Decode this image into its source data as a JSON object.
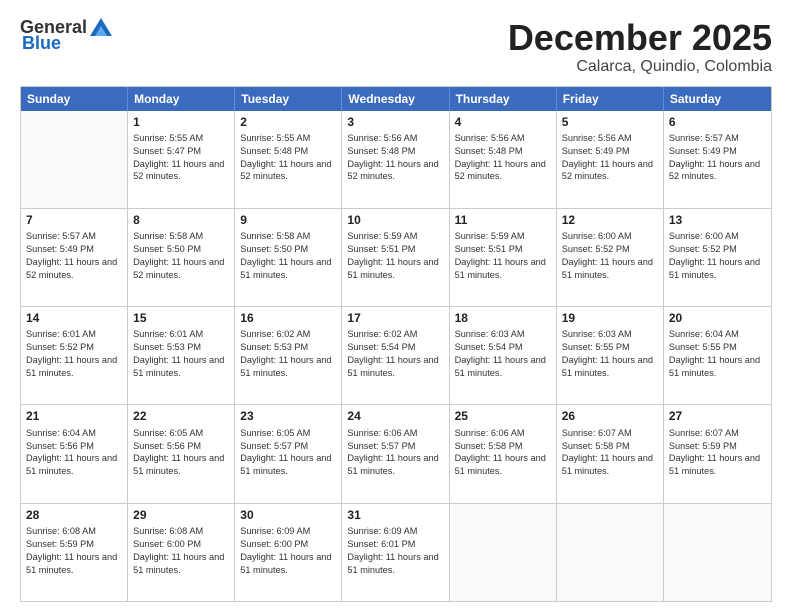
{
  "logo": {
    "general": "General",
    "blue": "Blue"
  },
  "title": "December 2025",
  "location": "Calarca, Quindio, Colombia",
  "header_days": [
    "Sunday",
    "Monday",
    "Tuesday",
    "Wednesday",
    "Thursday",
    "Friday",
    "Saturday"
  ],
  "weeks": [
    [
      {
        "day": "",
        "sunrise": "",
        "sunset": "",
        "daylight": ""
      },
      {
        "day": "1",
        "sunrise": "Sunrise: 5:55 AM",
        "sunset": "Sunset: 5:47 PM",
        "daylight": "Daylight: 11 hours and 52 minutes."
      },
      {
        "day": "2",
        "sunrise": "Sunrise: 5:55 AM",
        "sunset": "Sunset: 5:48 PM",
        "daylight": "Daylight: 11 hours and 52 minutes."
      },
      {
        "day": "3",
        "sunrise": "Sunrise: 5:56 AM",
        "sunset": "Sunset: 5:48 PM",
        "daylight": "Daylight: 11 hours and 52 minutes."
      },
      {
        "day": "4",
        "sunrise": "Sunrise: 5:56 AM",
        "sunset": "Sunset: 5:48 PM",
        "daylight": "Daylight: 11 hours and 52 minutes."
      },
      {
        "day": "5",
        "sunrise": "Sunrise: 5:56 AM",
        "sunset": "Sunset: 5:49 PM",
        "daylight": "Daylight: 11 hours and 52 minutes."
      },
      {
        "day": "6",
        "sunrise": "Sunrise: 5:57 AM",
        "sunset": "Sunset: 5:49 PM",
        "daylight": "Daylight: 11 hours and 52 minutes."
      }
    ],
    [
      {
        "day": "7",
        "sunrise": "Sunrise: 5:57 AM",
        "sunset": "Sunset: 5:49 PM",
        "daylight": "Daylight: 11 hours and 52 minutes."
      },
      {
        "day": "8",
        "sunrise": "Sunrise: 5:58 AM",
        "sunset": "Sunset: 5:50 PM",
        "daylight": "Daylight: 11 hours and 52 minutes."
      },
      {
        "day": "9",
        "sunrise": "Sunrise: 5:58 AM",
        "sunset": "Sunset: 5:50 PM",
        "daylight": "Daylight: 11 hours and 51 minutes."
      },
      {
        "day": "10",
        "sunrise": "Sunrise: 5:59 AM",
        "sunset": "Sunset: 5:51 PM",
        "daylight": "Daylight: 11 hours and 51 minutes."
      },
      {
        "day": "11",
        "sunrise": "Sunrise: 5:59 AM",
        "sunset": "Sunset: 5:51 PM",
        "daylight": "Daylight: 11 hours and 51 minutes."
      },
      {
        "day": "12",
        "sunrise": "Sunrise: 6:00 AM",
        "sunset": "Sunset: 5:52 PM",
        "daylight": "Daylight: 11 hours and 51 minutes."
      },
      {
        "day": "13",
        "sunrise": "Sunrise: 6:00 AM",
        "sunset": "Sunset: 5:52 PM",
        "daylight": "Daylight: 11 hours and 51 minutes."
      }
    ],
    [
      {
        "day": "14",
        "sunrise": "Sunrise: 6:01 AM",
        "sunset": "Sunset: 5:52 PM",
        "daylight": "Daylight: 11 hours and 51 minutes."
      },
      {
        "day": "15",
        "sunrise": "Sunrise: 6:01 AM",
        "sunset": "Sunset: 5:53 PM",
        "daylight": "Daylight: 11 hours and 51 minutes."
      },
      {
        "day": "16",
        "sunrise": "Sunrise: 6:02 AM",
        "sunset": "Sunset: 5:53 PM",
        "daylight": "Daylight: 11 hours and 51 minutes."
      },
      {
        "day": "17",
        "sunrise": "Sunrise: 6:02 AM",
        "sunset": "Sunset: 5:54 PM",
        "daylight": "Daylight: 11 hours and 51 minutes."
      },
      {
        "day": "18",
        "sunrise": "Sunrise: 6:03 AM",
        "sunset": "Sunset: 5:54 PM",
        "daylight": "Daylight: 11 hours and 51 minutes."
      },
      {
        "day": "19",
        "sunrise": "Sunrise: 6:03 AM",
        "sunset": "Sunset: 5:55 PM",
        "daylight": "Daylight: 11 hours and 51 minutes."
      },
      {
        "day": "20",
        "sunrise": "Sunrise: 6:04 AM",
        "sunset": "Sunset: 5:55 PM",
        "daylight": "Daylight: 11 hours and 51 minutes."
      }
    ],
    [
      {
        "day": "21",
        "sunrise": "Sunrise: 6:04 AM",
        "sunset": "Sunset: 5:56 PM",
        "daylight": "Daylight: 11 hours and 51 minutes."
      },
      {
        "day": "22",
        "sunrise": "Sunrise: 6:05 AM",
        "sunset": "Sunset: 5:56 PM",
        "daylight": "Daylight: 11 hours and 51 minutes."
      },
      {
        "day": "23",
        "sunrise": "Sunrise: 6:05 AM",
        "sunset": "Sunset: 5:57 PM",
        "daylight": "Daylight: 11 hours and 51 minutes."
      },
      {
        "day": "24",
        "sunrise": "Sunrise: 6:06 AM",
        "sunset": "Sunset: 5:57 PM",
        "daylight": "Daylight: 11 hours and 51 minutes."
      },
      {
        "day": "25",
        "sunrise": "Sunrise: 6:06 AM",
        "sunset": "Sunset: 5:58 PM",
        "daylight": "Daylight: 11 hours and 51 minutes."
      },
      {
        "day": "26",
        "sunrise": "Sunrise: 6:07 AM",
        "sunset": "Sunset: 5:58 PM",
        "daylight": "Daylight: 11 hours and 51 minutes."
      },
      {
        "day": "27",
        "sunrise": "Sunrise: 6:07 AM",
        "sunset": "Sunset: 5:59 PM",
        "daylight": "Daylight: 11 hours and 51 minutes."
      }
    ],
    [
      {
        "day": "28",
        "sunrise": "Sunrise: 6:08 AM",
        "sunset": "Sunset: 5:59 PM",
        "daylight": "Daylight: 11 hours and 51 minutes."
      },
      {
        "day": "29",
        "sunrise": "Sunrise: 6:08 AM",
        "sunset": "Sunset: 6:00 PM",
        "daylight": "Daylight: 11 hours and 51 minutes."
      },
      {
        "day": "30",
        "sunrise": "Sunrise: 6:09 AM",
        "sunset": "Sunset: 6:00 PM",
        "daylight": "Daylight: 11 hours and 51 minutes."
      },
      {
        "day": "31",
        "sunrise": "Sunrise: 6:09 AM",
        "sunset": "Sunset: 6:01 PM",
        "daylight": "Daylight: 11 hours and 51 minutes."
      },
      {
        "day": "",
        "sunrise": "",
        "sunset": "",
        "daylight": ""
      },
      {
        "day": "",
        "sunrise": "",
        "sunset": "",
        "daylight": ""
      },
      {
        "day": "",
        "sunrise": "",
        "sunset": "",
        "daylight": ""
      }
    ]
  ]
}
